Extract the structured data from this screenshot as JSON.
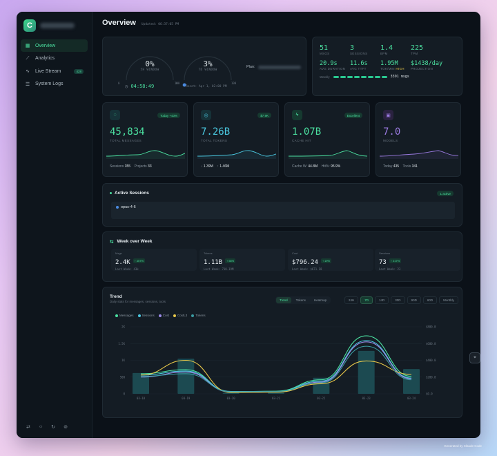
{
  "sidebar": {
    "logo_letter": "C",
    "items": [
      {
        "label": "Overview",
        "icon": "grid-icon"
      },
      {
        "label": "Analytics",
        "icon": "chart-icon"
      },
      {
        "label": "Live Stream",
        "icon": "pulse-icon",
        "badge": "428"
      },
      {
        "label": "System Logs",
        "icon": "list-icon"
      }
    ],
    "bottom_icons": [
      "translate-icon",
      "sun-icon",
      "refresh-icon",
      "eye-off-icon"
    ]
  },
  "header": {
    "title": "Overview",
    "updated": "Updated: 06:37:05 PM"
  },
  "usage": {
    "gauge1_value": "0%",
    "gauge1_label": "5H WINDOW",
    "gauge1_timer": "04:58:49",
    "gauge2_value": "3%",
    "gauge2_label": "7D WINDOW",
    "gauge2_reset": "Reset: Apr 1, 02:00 PM",
    "gauge2_fill": 0.03,
    "plan_label": "Plan:",
    "gauge_ticks": [
      "0",
      "50",
      "100"
    ]
  },
  "live": {
    "row1": [
      {
        "value": "51",
        "label": "MSGS"
      },
      {
        "value": "3",
        "label": "SESSIONS"
      },
      {
        "value": "1.4",
        "label": "BPM"
      },
      {
        "value": "225",
        "label": "TPM"
      }
    ],
    "row2": [
      {
        "value": "20.9s",
        "label": "AVG DURATION"
      },
      {
        "value": "11.6s",
        "label": "AVG TTFT"
      },
      {
        "value": "1.95M",
        "label": "TOK/MIN",
        "tag": "HIGH"
      },
      {
        "value": "$1438/day",
        "label": "PROJECTION"
      }
    ],
    "weekly_label": "Weekly",
    "weekly_value": "3391 msgs"
  },
  "tiles": [
    {
      "icon": "chat-icon",
      "pill": "Today +43%",
      "value": "45,834",
      "label": "TOTAL MESSAGES",
      "foot1_label": "Sessions",
      "foot1_value": "355",
      "foot2_label": "Projects",
      "foot2_value": "33",
      "color": "#4be0a0"
    },
    {
      "icon": "coins-icon",
      "pill": "$7.9K",
      "value": "7.26B",
      "label": "TOTAL TOKENS",
      "foot1_label": "↓",
      "foot1_value": "1.39M",
      "foot2_label": "↑",
      "foot2_value": "1.46M",
      "color": "#4ac8e0"
    },
    {
      "icon": "bolt-icon",
      "pill": "Excellent",
      "value": "1.07B",
      "label": "CACHE HIT",
      "foot1_label": "Cache W:",
      "foot1_value": "44.8M",
      "foot2_label": "Hit%:",
      "foot2_value": "95.9%",
      "color": "#4be0a0"
    },
    {
      "icon": "cpu-icon",
      "pill": "",
      "value": "7.0",
      "label": "MODELS",
      "foot1_label": "Today",
      "foot1_value": "435",
      "foot2_label": "Tools",
      "foot2_value": "341",
      "color": "#9a7ae0"
    }
  ],
  "sessions": {
    "title": "Active Sessions",
    "badge": "1 active",
    "row": "opus-4-6"
  },
  "wow": {
    "title": "Week over Week",
    "cells": [
      {
        "label": "Msgs",
        "value": "2.4K",
        "change": "↑ 457%",
        "last": "Last Week: 43k"
      },
      {
        "label": "Tokens",
        "value": "1.11B",
        "change": "↑ 58%",
        "last": "Last Week: 718.19M"
      },
      {
        "label": "Cost",
        "value": "$796.24",
        "change": "↑ 19%",
        "last": "Last Week: $671.18"
      },
      {
        "label": "Sessions",
        "value": "73",
        "change": "↑ 217%",
        "last": "Last Week: 23"
      }
    ]
  },
  "trend": {
    "title": "Trend",
    "subtitle": "Daily stats for messages, sessions, tools",
    "view_tabs": [
      "Trend",
      "Tokens",
      "Heatmap"
    ],
    "ranges": [
      "24H",
      "7D",
      "14D",
      "30D",
      "90D",
      "60D",
      "Monthly"
    ],
    "legend": [
      {
        "name": "Messages",
        "color": "#4be0a0"
      },
      {
        "name": "Sessions",
        "color": "#4ac8e0"
      },
      {
        "name": "Cost",
        "color": "#9a8ae8"
      },
      {
        "name": "CostL3",
        "color": "#e8c84a"
      },
      {
        "name": "Tokens",
        "color": "#3a9aa0"
      }
    ]
  },
  "chart_data": {
    "type": "line",
    "categories": [
      "03-18",
      "03-19",
      "03-20",
      "03-21",
      "03-22",
      "03-23",
      "03-24"
    ],
    "left_ticks": [
      "2K",
      "1.5K",
      "1K",
      "500",
      "0"
    ],
    "right_ticks": [
      "$800.0",
      "$600.0",
      "$400.0",
      "$200.0",
      "$0.0"
    ],
    "bars": [
      620,
      1050,
      30,
      40,
      480,
      1280,
      740
    ],
    "series": [
      {
        "name": "Messages",
        "values": [
          600,
          720,
          60,
          80,
          420,
          1730,
          520
        ]
      },
      {
        "name": "Sessions",
        "values": [
          560,
          680,
          70,
          70,
          380,
          1590,
          470
        ]
      },
      {
        "name": "Cost",
        "values": [
          500,
          650,
          50,
          60,
          350,
          1550,
          450
        ]
      },
      {
        "name": "CostL3",
        "values": [
          560,
          1000,
          40,
          50,
          300,
          980,
          580
        ]
      },
      {
        "name": "Tokens",
        "values": [
          520,
          600,
          60,
          70,
          330,
          1420,
          420
        ]
      }
    ],
    "ylim": [
      0,
      2000
    ]
  },
  "watermark": "Generated by Claude Code"
}
